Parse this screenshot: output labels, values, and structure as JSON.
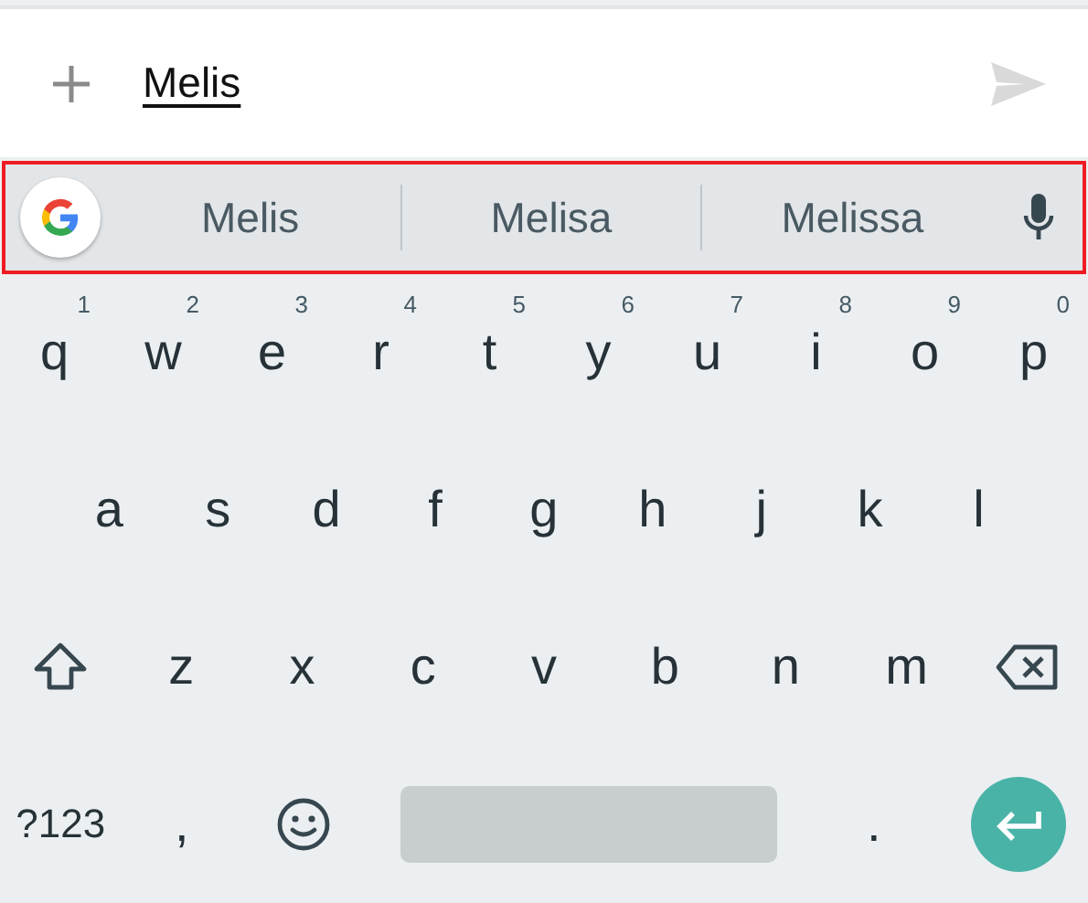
{
  "compose": {
    "value": "Melis"
  },
  "suggestions": [
    {
      "text": "Melis"
    },
    {
      "text": "Melisa"
    },
    {
      "text": "Melissa"
    }
  ],
  "highlight": {
    "color": "#ee1c24"
  },
  "rows": [
    [
      {
        "label": "q",
        "hint": "1"
      },
      {
        "label": "w",
        "hint": "2"
      },
      {
        "label": "e",
        "hint": "3"
      },
      {
        "label": "r",
        "hint": "4"
      },
      {
        "label": "t",
        "hint": "5"
      },
      {
        "label": "y",
        "hint": "6"
      },
      {
        "label": "u",
        "hint": "7"
      },
      {
        "label": "i",
        "hint": "8"
      },
      {
        "label": "o",
        "hint": "9"
      },
      {
        "label": "p",
        "hint": "0"
      }
    ],
    [
      {
        "label": "a"
      },
      {
        "label": "s"
      },
      {
        "label": "d"
      },
      {
        "label": "f"
      },
      {
        "label": "g"
      },
      {
        "label": "h"
      },
      {
        "label": "j"
      },
      {
        "label": "k"
      },
      {
        "label": "l"
      }
    ],
    [
      {
        "kind": "shift"
      },
      {
        "label": "z"
      },
      {
        "label": "x"
      },
      {
        "label": "c"
      },
      {
        "label": "v"
      },
      {
        "label": "b"
      },
      {
        "label": "n"
      },
      {
        "label": "m"
      },
      {
        "kind": "backspace"
      }
    ]
  ],
  "bottom": [
    {
      "kind": "symbols",
      "label": "?123"
    },
    {
      "kind": "char",
      "label": ","
    },
    {
      "kind": "emoji"
    },
    {
      "kind": "space"
    },
    {
      "kind": "char",
      "label": "."
    },
    {
      "kind": "enter"
    }
  ]
}
